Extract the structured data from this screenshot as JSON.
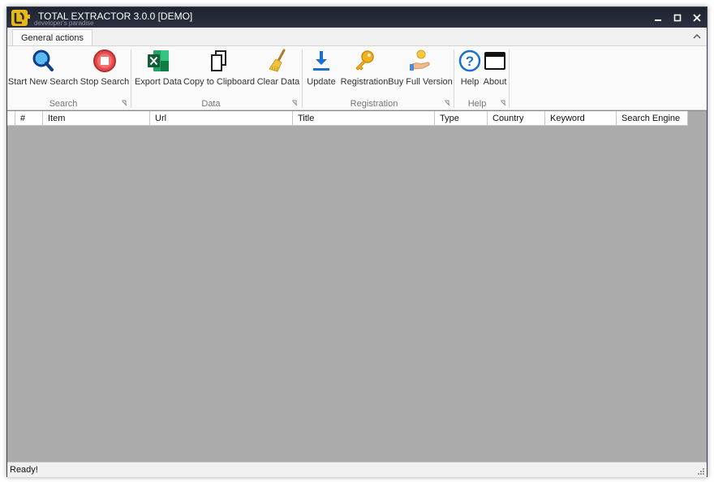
{
  "window": {
    "title": "TOTAL EXTRACTOR 3.0.0 [DEMO]",
    "logo_subtitle": "developer's paradise"
  },
  "ribbon": {
    "active_tab": "General actions",
    "groups": [
      {
        "label": "Search",
        "buttons": [
          {
            "label": "Start New Search",
            "icon": "magnifier-icon"
          },
          {
            "label": "Stop Search",
            "icon": "stop-icon"
          }
        ]
      },
      {
        "label": "Data",
        "buttons": [
          {
            "label": "Export Data",
            "icon": "excel-icon"
          },
          {
            "label": "Copy to Clipboard",
            "icon": "copy-icon"
          },
          {
            "label": "Clear Data",
            "icon": "broom-icon"
          }
        ]
      },
      {
        "label": "Registration",
        "buttons": [
          {
            "label": "Update",
            "icon": "download-icon"
          },
          {
            "label": "Registration",
            "icon": "key-icon"
          },
          {
            "label": "Buy Full Version",
            "icon": "hand-coin-icon"
          }
        ]
      },
      {
        "label": "Help",
        "buttons": [
          {
            "label": "Help",
            "icon": "help-icon"
          },
          {
            "label": "About",
            "icon": "window-icon"
          }
        ]
      }
    ]
  },
  "grid": {
    "columns": [
      "#",
      "Item",
      "Url",
      "Title",
      "Type",
      "Country",
      "Keyword",
      "Search Engine"
    ]
  },
  "status": {
    "text": "Ready!"
  },
  "colors": {
    "titlebar": "#1e2330",
    "grid_background": "#ababab",
    "accent_blue": "#1a6fd1",
    "stop_red": "#d93a3a",
    "excel_green": "#1d7a44"
  }
}
